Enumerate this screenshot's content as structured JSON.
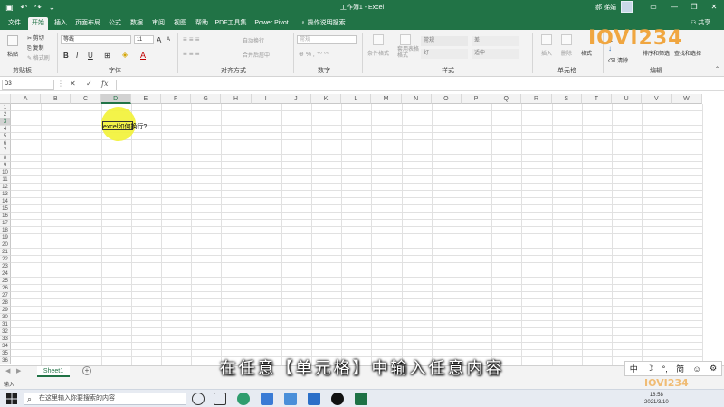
{
  "window": {
    "title": "工作簿1  -  Excel",
    "user": "郝 娣娟",
    "qat": [
      "↶",
      "↷",
      "⌄"
    ],
    "buttons": [
      "—",
      "❐",
      "✕"
    ]
  },
  "menu": {
    "tabs": [
      "文件",
      "开始",
      "插入",
      "页面布局",
      "公式",
      "数据",
      "审阅",
      "视图",
      "帮助",
      "PDF工具集",
      "Power Pivot",
      "操作说明搜索"
    ],
    "active": "开始",
    "share": "共享"
  },
  "ribbon": {
    "clipboard": {
      "paste": "粘贴",
      "cut": "剪切",
      "copy": "复制",
      "format_painter": "格式刷",
      "label": "剪贴板"
    },
    "font": {
      "name": "等线",
      "size": "11",
      "bold": "B",
      "italic": "I",
      "underline": "U",
      "grow": "A",
      "shrink": "A",
      "label": "字体"
    },
    "alignment": {
      "wrap": "自动换行",
      "merge": "合并后居中",
      "label": "对齐方式"
    },
    "number": {
      "format": "常规",
      "label": "数字"
    },
    "styles": {
      "conditional": "条件格式",
      "table": "套用表格格式",
      "cells": [
        "常规",
        "差",
        "好",
        "适中"
      ],
      "label": "样式"
    },
    "cells": {
      "insert": "插入",
      "delete": "删除",
      "format": "格式",
      "label": "单元格"
    },
    "editing": {
      "sort": "排序和筛选",
      "find": "查找和选择",
      "clear": "清除",
      "label": "编辑"
    }
  },
  "formula_bar": {
    "name_box": "D3",
    "cancel": "✕",
    "enter": "✓",
    "fx": "fx"
  },
  "grid": {
    "columns": [
      "A",
      "B",
      "C",
      "D",
      "E",
      "F",
      "G",
      "H",
      "I",
      "J",
      "K",
      "L",
      "M",
      "N",
      "O",
      "P",
      "Q",
      "R",
      "S",
      "T",
      "U",
      "V",
      "W"
    ],
    "selected_column": "D",
    "selected_row": 3,
    "rows": 36,
    "cell_D3": "excel如何换行?"
  },
  "sheets": {
    "tabs": [
      "Sheet1"
    ],
    "add": "+"
  },
  "status": {
    "mode": "输入"
  },
  "subtitle": "在任意【单元格】中输入任意内容",
  "ime": [
    "中",
    "☽",
    "°,",
    "简",
    "☺",
    "⚙"
  ],
  "logo": "IOVI234",
  "taskbar": {
    "search_placeholder": "在这里输入你要搜索的内容",
    "time": "18:58",
    "date": "2021/3/10"
  }
}
